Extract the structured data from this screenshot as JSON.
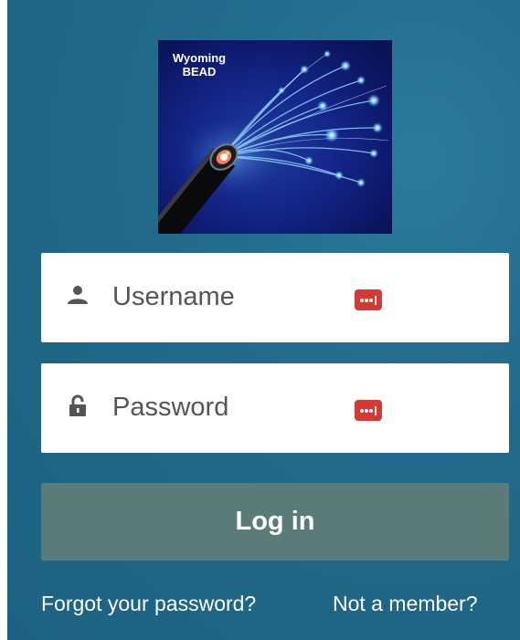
{
  "logo": {
    "line1": "Wyoming",
    "line2": "BEAD",
    "image": "fiber-optic-cable-illustration"
  },
  "form": {
    "username": {
      "placeholder": "Username",
      "value": "",
      "icon": "user-icon"
    },
    "password": {
      "placeholder": "Password",
      "value": "",
      "icon": "lock-icon"
    },
    "password_manager_icon": "password-manager-icon",
    "login_label": "Log in"
  },
  "links": {
    "forgot_password": "Forgot your password?",
    "not_member": "Not a member?"
  },
  "colors": {
    "panel_background": "#226c8d",
    "login_button": "#5a7b78",
    "password_manager_badge": "#d43a35",
    "input_background": "#ffffff",
    "placeholder_text": "#555555"
  }
}
